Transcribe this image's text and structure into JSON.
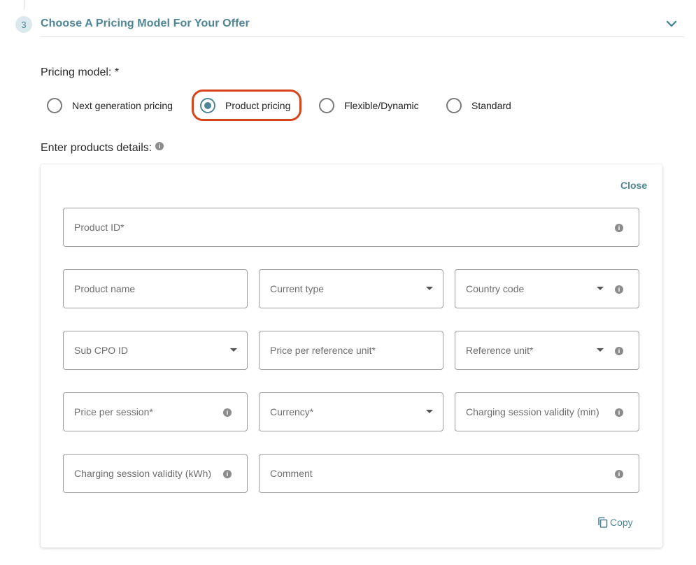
{
  "step": {
    "number": "3",
    "title": "Choose A Pricing Model For Your Offer"
  },
  "pricing_model": {
    "label": "Pricing model: *",
    "options": [
      {
        "label": "Next generation pricing",
        "selected": false
      },
      {
        "label": "Product pricing",
        "selected": true
      },
      {
        "label": "Flexible/Dynamic",
        "selected": false
      },
      {
        "label": "Standard",
        "selected": false
      }
    ]
  },
  "details": {
    "label": "Enter products details:",
    "info_icon": "i",
    "close_label": "Close",
    "copy_label": "Copy",
    "fields": {
      "product_id": "Product ID*",
      "product_name": "Product name",
      "current_type": "Current type",
      "country_code": "Country code",
      "sub_cpo_id": "Sub CPO ID",
      "price_per_reference_unit": "Price per reference unit*",
      "reference_unit": "Reference unit*",
      "price_per_session": "Price per session*",
      "currency": "Currency*",
      "charging_session_validity_min": "Charging session validity (min)",
      "charging_session_validity_kwh": "Charging session validity (kWh)",
      "comment": "Comment"
    }
  },
  "colors": {
    "accent": "#4e8696",
    "highlight": "#d7441b",
    "field_border": "#9e9e9e"
  },
  "icons": [
    "chevron-down-icon",
    "info-icon",
    "dropdown-caret-icon",
    "copy-icon"
  ]
}
